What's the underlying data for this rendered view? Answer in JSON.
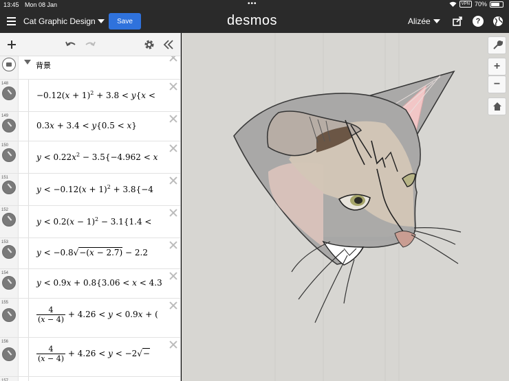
{
  "status": {
    "time": "13:45",
    "date": "Mon 08 Jan",
    "vpn": "VPN",
    "battery": "70%",
    "battery_level": 0.7,
    "dots": "•••"
  },
  "header": {
    "graph_title": "Cat Graphic Design",
    "save_label": "Save",
    "logo": "desmos",
    "user": "Alizée",
    "help": "?"
  },
  "folder": {
    "label": "背景"
  },
  "expressions": [
    {
      "num": "148"
    },
    {
      "num": "149"
    },
    {
      "num": "150"
    },
    {
      "num": "151"
    },
    {
      "num": "152"
    },
    {
      "num": "153"
    },
    {
      "num": "154"
    },
    {
      "num": "155"
    },
    {
      "num": "156"
    },
    {
      "num": "157"
    }
  ],
  "zoom": {
    "plus": "+",
    "minus": "−"
  },
  "colors": {
    "accent": "#2f72dc",
    "topbar": "#2a2a2a",
    "paper": "#d7d6d2"
  }
}
